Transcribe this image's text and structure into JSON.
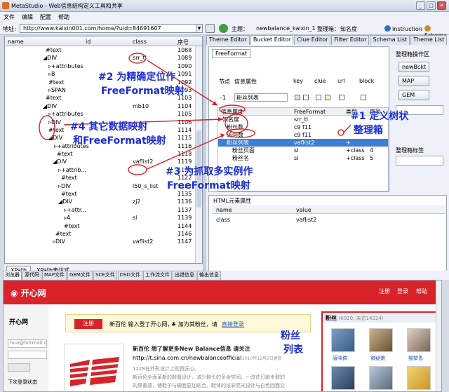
{
  "window": {
    "title": "MetaStudio - Web信息结构定义工具和共享"
  },
  "menu": [
    "文件",
    "编辑",
    "配置",
    "帮助"
  ],
  "address": {
    "label": "地址:",
    "url": "http://www.kaixin001.com/home/?uid=84691607",
    "subject_label": "主题：",
    "subject_value": "newbalance_kaixin_1",
    "org_label": "整理箱：",
    "org_value": "知名度",
    "instruction": "Instruction",
    "schema": "Schema"
  },
  "left_headers": [
    "name",
    "id",
    "class",
    "序号"
  ],
  "left_rows": [
    {
      "name": "#text",
      "id": "",
      "cls": "",
      "num": "1088",
      "ind": 58
    },
    {
      "name": "◢DIV",
      "id": "",
      "cls": "srr_tl",
      "num": "1089",
      "ind": 54
    },
    {
      "name": "▹+attributes",
      "id": "",
      "cls": "",
      "num": "1090",
      "ind": 62
    },
    {
      "name": "▹B",
      "id": "",
      "cls": "",
      "num": "1091",
      "ind": 62
    },
    {
      "name": "#text",
      "id": "",
      "cls": "",
      "num": "1092",
      "ind": 62
    },
    {
      "name": "▹SPAN",
      "id": "",
      "cls": "",
      "num": "1093",
      "ind": 62
    },
    {
      "name": "#text",
      "id": "",
      "cls": "",
      "num": "1103",
      "ind": 58
    },
    {
      "name": "◢DIV",
      "id": "",
      "cls": "mb10",
      "num": "1104",
      "ind": 54
    },
    {
      "name": "▹+attributes",
      "id": "",
      "cls": "",
      "num": "1105",
      "ind": 62
    },
    {
      "name": "▹DIV",
      "id": "",
      "cls": "",
      "num": "1106",
      "ind": 62
    },
    {
      "name": "#text",
      "id": "",
      "cls": "",
      "num": "1114",
      "ind": 62
    },
    {
      "name": "◢DIV",
      "id": "",
      "cls": "",
      "num": "1115",
      "ind": 62
    },
    {
      "name": "▹+attributes",
      "id": "",
      "cls": "",
      "num": "1116",
      "ind": 70
    },
    {
      "name": "#text",
      "id": "",
      "cls": "",
      "num": "1118",
      "ind": 74
    },
    {
      "name": "◢DIV",
      "id": "",
      "cls": "vaflist2",
      "num": "1119",
      "ind": 68
    },
    {
      "name": "▹+attrib...",
      "id": "",
      "cls": "",
      "num": "1120",
      "ind": 76
    },
    {
      "name": "#text",
      "id": "",
      "cls": "",
      "num": "1122",
      "ind": 80
    },
    {
      "name": "▹DIV",
      "id": "",
      "cls": "l50_s_list",
      "num": "1123",
      "ind": 76
    },
    {
      "name": "#text",
      "id": "",
      "cls": "",
      "num": "1135",
      "ind": 80
    },
    {
      "name": "◢DIV",
      "id": "",
      "cls": "zj2",
      "num": "1136",
      "ind": 76
    },
    {
      "name": "▹+attr...",
      "id": "",
      "cls": "",
      "num": "1137",
      "ind": 84
    },
    {
      "name": "▹A",
      "id": "",
      "cls": "sl",
      "num": "1139",
      "ind": 84
    },
    {
      "name": "#text",
      "id": "",
      "cls": "",
      "num": "1144",
      "ind": 84
    },
    {
      "name": "#text",
      "id": "",
      "cls": "",
      "num": "1146",
      "ind": 72
    },
    {
      "name": "▹DIV",
      "id": "",
      "cls": "vaflist2",
      "num": "1147",
      "ind": 68
    }
  ],
  "xpath": {
    "button": "XPath",
    "label": "XPath表达式"
  },
  "tabs": [
    "Theme Editor",
    "Bucket Editor",
    "Clue Editor",
    "Filter Editor",
    "Schema List",
    "Theme List"
  ],
  "ff": {
    "tab": "FreeFormat",
    "headers": [
      "节点",
      "信息属性",
      "key",
      "clue",
      "url",
      "block"
    ],
    "node": "-1",
    "attr": "粉丝列表"
  },
  "tree2_headers": [
    "信息属性",
    "FreeFormat",
    "类型",
    "序号"
  ],
  "tree2_rows": [
    {
      "a": "知名度",
      "f": "srr_tl",
      "t": "",
      "n": "",
      "ind": 6,
      "sel": false
    },
    {
      "a": "粉丝数",
      "f": "c9 f11",
      "t": "",
      "n": "",
      "ind": 12,
      "sel": false
    },
    {
      "a": "访问数",
      "f": "c9 f11",
      "t": "",
      "n": "",
      "ind": 12,
      "sel": false
    },
    {
      "a": "粉丝列表",
      "f": "vaflist2",
      "t": "+",
      "n": "",
      "ind": 12,
      "sel": true
    },
    {
      "a": "粉丝页面",
      "f": "sl",
      "t": "+class",
      "n": "4",
      "ind": 20,
      "sel": false
    },
    {
      "a": "粉丝名",
      "f": "sl",
      "t": "+class",
      "n": "5",
      "ind": 20,
      "sel": false
    }
  ],
  "side": {
    "title": "整理箱操作区",
    "buttons": [
      "newBckt",
      "MAP",
      "GEM"
    ],
    "label2": "整理箱标签"
  },
  "html_panel": {
    "title": "HTML元素属性",
    "headers": [
      "name",
      "value"
    ],
    "row": [
      "class",
      "vaflist2"
    ]
  },
  "browser_tabs": [
    "浏览器",
    "源代码",
    "MAP文件",
    "GEM文件",
    "SCE文件",
    "DSD文件",
    "工作流文件",
    "出错信息",
    "输出信息"
  ],
  "page": {
    "logo": "开心网",
    "links": [
      "注册",
      "登录",
      "帮助"
    ],
    "left_name": "开心网",
    "left_email": "hua@hotmail.c",
    "left_remember": "下次登录状态",
    "notice_btn": "注册",
    "notice_t1": "新百伦 输入登了开心网，",
    "notice_t2": "加为其粉丝，请",
    "notice_link": "直接登录",
    "nb_title": "新百伦 想了解更多New Balance信息 请关注",
    "nb_url": "http://t.sina.com.cn/newbalanceofficial",
    "nb_date": "2010年12月2日更新",
    "nb_l1": "1228在外形设计上别具匠心。",
    "nb_l2": "新百伦全面革新的鞋履设计，减少鞋头的多余空间，一改往日跑步鞋的",
    "nb_l3": "的厚重感，使鞋子与脚面更加贴合。鞋体的炫彩亮光设计与白色回面交",
    "fans_title": "粉丝",
    "fans_count": "(6020, 未访14224)",
    "fans_names": [
      "唐咪搞",
      "微疑娘",
      "翘黎恩"
    ]
  },
  "annotations": {
    "a1": "#1 定义树状",
    "a1b": "整理箱",
    "a2": "#2 为精确定位作",
    "a2b": "FreeFormat映射",
    "a3": "#3 为抓取多实例作",
    "a3b": "FreeFormat映射",
    "a4": "#4 其它数据映射",
    "a4b": "和FreeFormat映射",
    "fans": "粉丝",
    "fans2": "列表"
  },
  "colors": {
    "annotation": "#1a2cd8",
    "highlight": "#d8232a",
    "accent": "#3d7fd6"
  }
}
